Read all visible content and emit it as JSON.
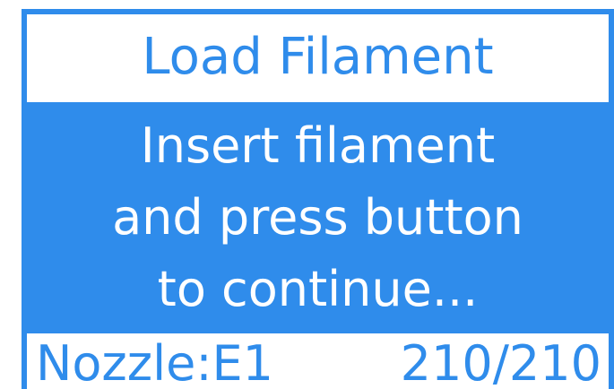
{
  "screen": {
    "title": "Load Filament",
    "message_lines": [
      "Insert filament",
      "and press button",
      "to continue..."
    ],
    "status": {
      "nozzle": "Nozzle:E1",
      "temperature": "210/210"
    }
  },
  "colors": {
    "accent": "#2F8CEB",
    "text_on_accent": "#FFFFFF",
    "background": "#FFFFFF"
  }
}
